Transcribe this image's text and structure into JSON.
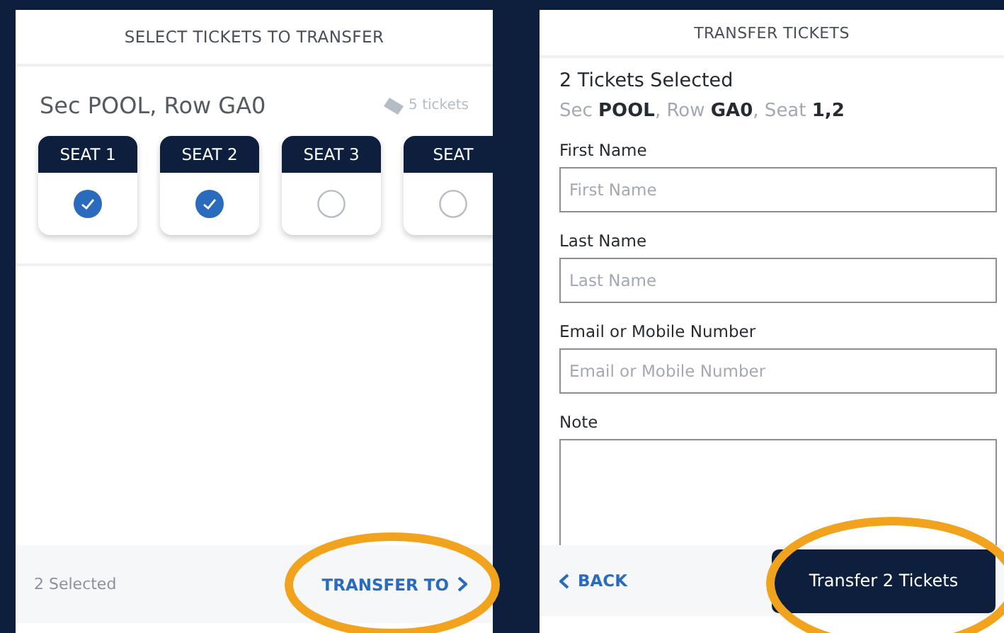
{
  "select_panel": {
    "title": "SELECT TICKETS TO TRANSFER",
    "section": "Sec POOL, Row GA0",
    "ticket_count": "5 tickets",
    "seats": [
      {
        "label": "SEAT 1",
        "selected": true
      },
      {
        "label": "SEAT 2",
        "selected": true
      },
      {
        "label": "SEAT 3",
        "selected": false
      },
      {
        "label": "SEAT",
        "selected": false
      }
    ],
    "footer": {
      "selected_count": "2 Selected",
      "action": "TRANSFER TO"
    }
  },
  "transfer_panel": {
    "title": "TRANSFER TICKETS",
    "summary": "2 Tickets Selected",
    "details": "Sec **POOL**, Row **GA0**, Seat **1,2**",
    "fields": [
      {
        "label": "First Name",
        "placeholder": "First Name",
        "kind": "input"
      },
      {
        "label": "Last Name",
        "placeholder": "Last Name",
        "kind": "input"
      },
      {
        "label": "Email or Mobile Number",
        "placeholder": "Email or Mobile Number",
        "kind": "input"
      },
      {
        "label": "Note",
        "kind": "textarea"
      }
    ],
    "back": "BACK",
    "submit": "Transfer 2 Tickets"
  }
}
